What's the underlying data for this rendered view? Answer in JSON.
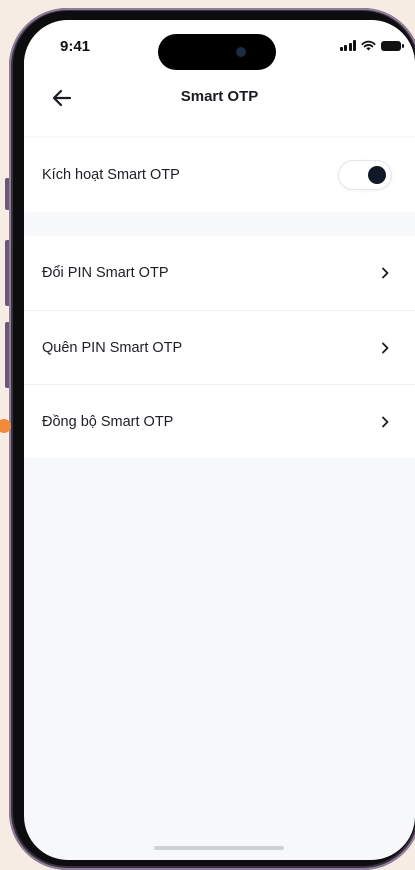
{
  "status_bar": {
    "time": "9:41"
  },
  "header": {
    "title": "Smart OTP",
    "back_icon": "arrow-left-icon"
  },
  "activation": {
    "label": "Kích hoạt Smart OTP",
    "toggle_on": true
  },
  "menu": {
    "items": [
      {
        "label": "Đổi PIN Smart OTP",
        "icon": "chevron-right-icon"
      },
      {
        "label": "Quên PIN Smart OTP",
        "icon": "chevron-right-icon"
      },
      {
        "label": "Đồng bộ Smart OTP",
        "icon": "chevron-right-icon"
      }
    ]
  },
  "colors": {
    "accent_dot": "#f08a3a",
    "toggle_knob": "#111827",
    "screen_background": "#f7f8fa",
    "page_background": "#f6ece3"
  }
}
